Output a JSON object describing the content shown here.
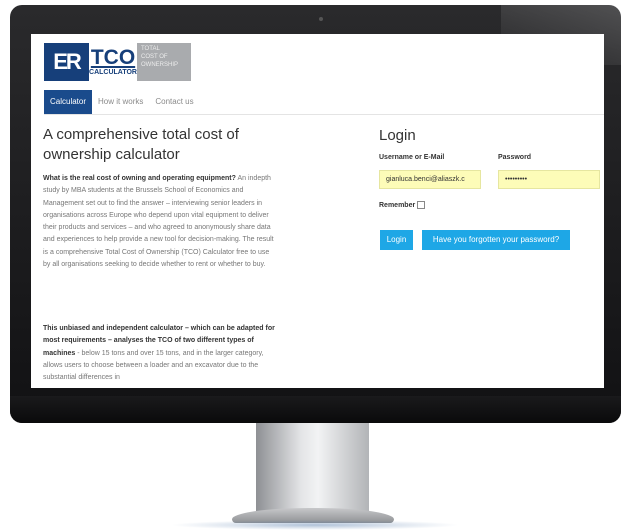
{
  "logo": {
    "er": "ER",
    "tco": "TCO",
    "calculator": "CALCULATOR",
    "desc_line1": "TOTAL",
    "desc_line2": "COST OF",
    "desc_line3": "OWNERSHIP"
  },
  "nav": {
    "items": [
      {
        "label": "Calculator"
      },
      {
        "label": "How it works"
      },
      {
        "label": "Contact us"
      }
    ]
  },
  "main": {
    "heading": "A comprehensive total cost of ownership calculator",
    "p1_bold": "What is the real cost of owning and operating equipment?",
    "p1_text": " An indepth study by MBA students at the Brussels School of Economics and Management set out to find the answer – interviewing senior leaders in organisations across Europe who depend upon vital equipment to deliver their products and services – and who agreed to anonymously share data and experiences to help provide a new tool for decision-making. The result is a comprehensive Total Cost of Ownership (TCO) Calculator free to use by all organisations seeking to decide whether to rent or whether to buy.",
    "p2_bold": "This unbiased and independent calculator – which can be adapted for most requirements – analyses the TCO of two different types of machines",
    "p2_text": " - below 15 tons and over 15 tons, and in the larger category, allows users to choose between a loader and an excavator due to the substantial differences in"
  },
  "login": {
    "title": "Login",
    "username_label": "Username or E-Mail",
    "password_label": "Password",
    "username_value": "gianluca.benci@aliaszk.c",
    "password_value": "•••••••••",
    "remember_label": "Remember",
    "login_button": "Login",
    "forgot_button": "Have you forgotten your password?"
  },
  "colors": {
    "accent": "#1a4b8c",
    "button": "#1ea7e6",
    "autofill": "#fdfcb8"
  }
}
